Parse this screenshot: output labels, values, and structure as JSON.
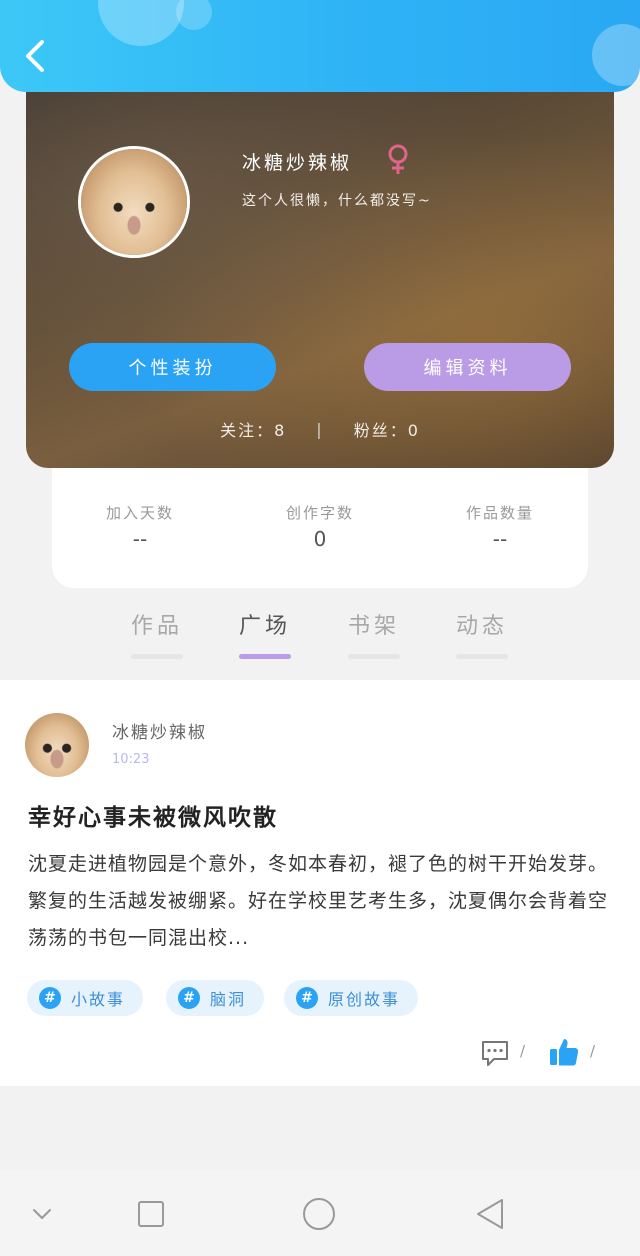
{
  "header": {
    "back_icon": "chevron-left-icon",
    "background_color": "#2fb3f6"
  },
  "profile": {
    "nickname": "冰糖炒辣椒",
    "gender_icon": "female-symbol-icon",
    "gender_color": "#e0658a",
    "bio": "这个人很懒，什么都没写~",
    "decorate_button_label": "个性装扮",
    "edit_button_label": "编辑资料",
    "following_text": "关注：8",
    "separator": "|",
    "followers_text": "粉丝：0"
  },
  "stats": [
    {
      "label": "加入天数",
      "value": "--"
    },
    {
      "label": "创作字数",
      "value": "0"
    },
    {
      "label": "作品数量",
      "value": "--"
    }
  ],
  "tabs": [
    {
      "label": "作品",
      "active": false
    },
    {
      "label": "广场",
      "active": true
    },
    {
      "label": "书架",
      "active": false
    },
    {
      "label": "动态",
      "active": false
    }
  ],
  "post": {
    "author": "冰糖炒辣椒",
    "time": "10:23",
    "title": "幸好心事未被微风吹散",
    "body": "沈夏走进植物园是个意外，冬如本春初，褪了色的树干开始发芽。繁复的生活越发被绷紧。好在学校里艺考生多，沈夏偶尔会背着空荡荡的书包一同混出校...",
    "tags": [
      {
        "symbol": "#",
        "text": "小故事"
      },
      {
        "symbol": "#",
        "text": "脑洞"
      },
      {
        "symbol": "#",
        "text": "原创故事"
      }
    ],
    "comment_icon": "comment-icon",
    "comment_count": "/",
    "like_icon": "thumbs-up-icon",
    "like_count": "/"
  },
  "navbar": {
    "icons": [
      "chevron-down-icon",
      "square-icon",
      "circle-icon",
      "triangle-back-icon"
    ]
  }
}
